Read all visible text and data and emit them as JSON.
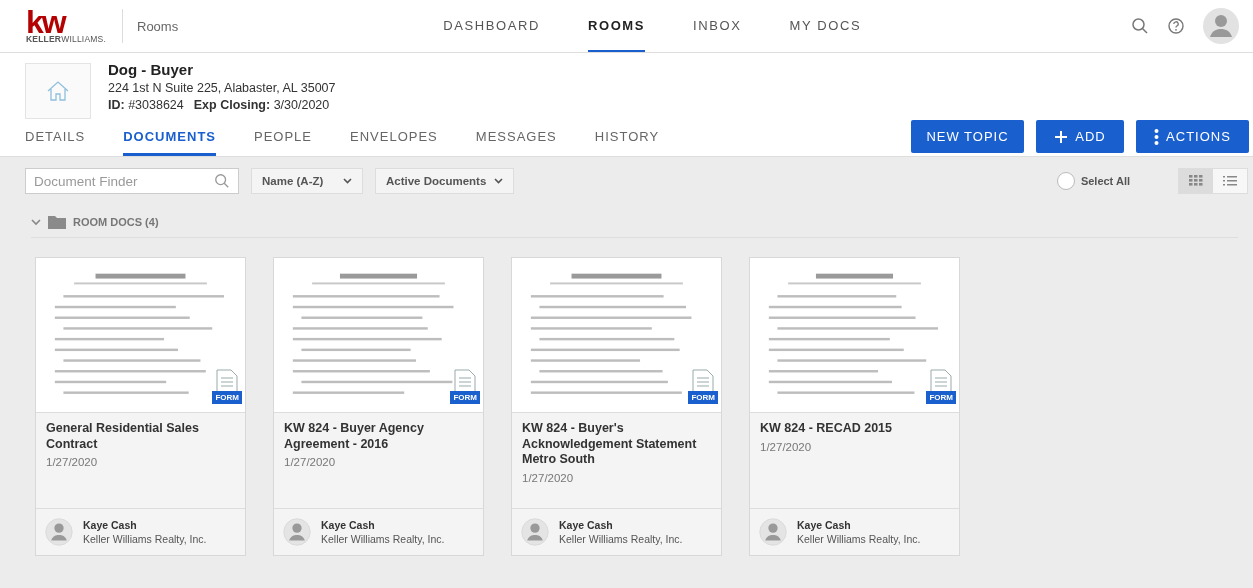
{
  "logo": {
    "mark": "kw",
    "wordmark": "**KELLER**WILLIAMS."
  },
  "app_section": "Rooms",
  "nav": [
    {
      "label": "DASHBOARD",
      "selected": false
    },
    {
      "label": "ROOMS",
      "selected": true
    },
    {
      "label": "INBOX",
      "selected": false
    },
    {
      "label": "MY DOCS",
      "selected": false
    }
  ],
  "room": {
    "title": "Dog - Buyer",
    "address": "224 1st N Suite 225, Alabaster, AL 35007",
    "id": "**ID:** #3038624",
    "closing": "**Exp Closing:** 3/30/2020"
  },
  "tabs": [
    {
      "label": "DETAILS",
      "selected": false
    },
    {
      "label": "DOCUMENTS",
      "selected": true
    },
    {
      "label": "PEOPLE",
      "selected": false
    },
    {
      "label": "ENVELOPES",
      "selected": false
    },
    {
      "label": "MESSAGES",
      "selected": false
    },
    {
      "label": "HISTORY",
      "selected": false
    }
  ],
  "actions": [
    {
      "label": "NEW TOPIC",
      "kind": "text"
    },
    {
      "label": "ADD",
      "kind": "add"
    },
    {
      "label": "ACTIONS",
      "kind": "menu"
    }
  ],
  "toolbar": {
    "search": {
      "placeholder": "Document Finder"
    },
    "sort": "Name (A-Z)",
    "filter": "Active Documents",
    "select_all": {
      "label": "Select All",
      "checked": false
    },
    "views": [
      {
        "kind": "grid",
        "selected": true
      },
      {
        "kind": "list",
        "selected": false
      }
    ]
  },
  "folder": {
    "label": "ROOM DOCS (4)",
    "expanded": true
  },
  "documents": [
    {
      "title": "General Residential Sales Contract",
      "date": "1/27/2020",
      "badge": "FORM",
      "owner": {
        "name": "Kaye Cash",
        "company": "Keller Williams Realty, Inc."
      }
    },
    {
      "title": "KW 824 - Buyer Agency Agreement - 2016",
      "date": "1/27/2020",
      "badge": "FORM",
      "owner": {
        "name": "Kaye Cash",
        "company": "Keller Williams Realty, Inc."
      }
    },
    {
      "title": "KW 824 - Buyer's Acknowledgement Statement Metro South",
      "date": "1/27/2020",
      "badge": "FORM",
      "owner": {
        "name": "Kaye Cash",
        "company": "Keller Williams Realty, Inc."
      }
    },
    {
      "title": "KW 824 - RECAD 2015",
      "date": "1/27/2020",
      "badge": "FORM",
      "owner": {
        "name": "Kaye Cash",
        "company": "Keller Williams Realty, Inc."
      }
    }
  ]
}
